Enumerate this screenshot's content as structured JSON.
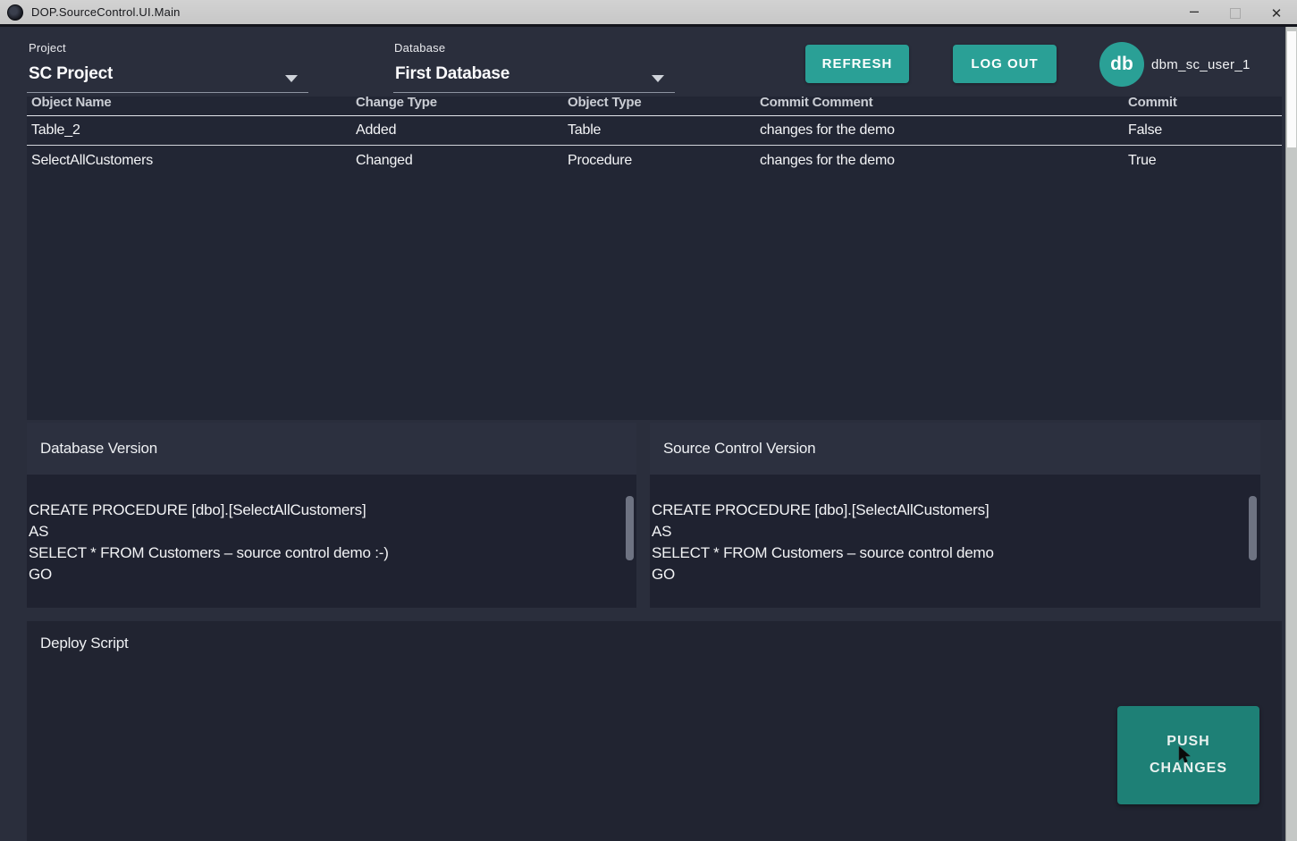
{
  "window": {
    "title": "DOP.SourceControl.UI.Main",
    "controls": {
      "minimize": "–",
      "close": "✕"
    }
  },
  "header": {
    "project": {
      "label": "Project",
      "value": "SC Project"
    },
    "database": {
      "label": "Database",
      "value": "First Database"
    },
    "refresh_label": "REFRESH",
    "logout_label": "LOG OUT",
    "avatar_initials": "db",
    "username": "dbm_sc_user_1"
  },
  "grid": {
    "columns": [
      "Object Name",
      "Change Type",
      "Object Type",
      "Commit Comment",
      "Commit"
    ],
    "rows": [
      {
        "object_name": "Table_2",
        "change_type": "Added",
        "object_type": "Table",
        "commit_comment": "changes for the demo",
        "commit": "False"
      },
      {
        "object_name": "SelectAllCustomers",
        "change_type": "Changed",
        "object_type": "Procedure",
        "commit_comment": "changes for the demo",
        "commit": "True"
      }
    ]
  },
  "database_version": {
    "title": "Database Version",
    "code": "CREATE PROCEDURE [dbo].[SelectAllCustomers]\nAS\nSELECT * FROM Customers – source control demo :-)\nGO"
  },
  "source_control_version": {
    "title": "Source Control Version",
    "code": "CREATE PROCEDURE [dbo].[SelectAllCustomers]\nAS\nSELECT * FROM Customers – source control demo\nGO"
  },
  "deploy_script": {
    "title": "Deploy Script"
  },
  "push_button": {
    "line1": "PUSH",
    "line2": "CHANGES"
  },
  "colors": {
    "accent_teal": "#2aa096",
    "push_teal": "#1e8076",
    "background": "#2a2e3c",
    "panel_dark": "#1f2230",
    "titlebar": "#cccccc"
  }
}
